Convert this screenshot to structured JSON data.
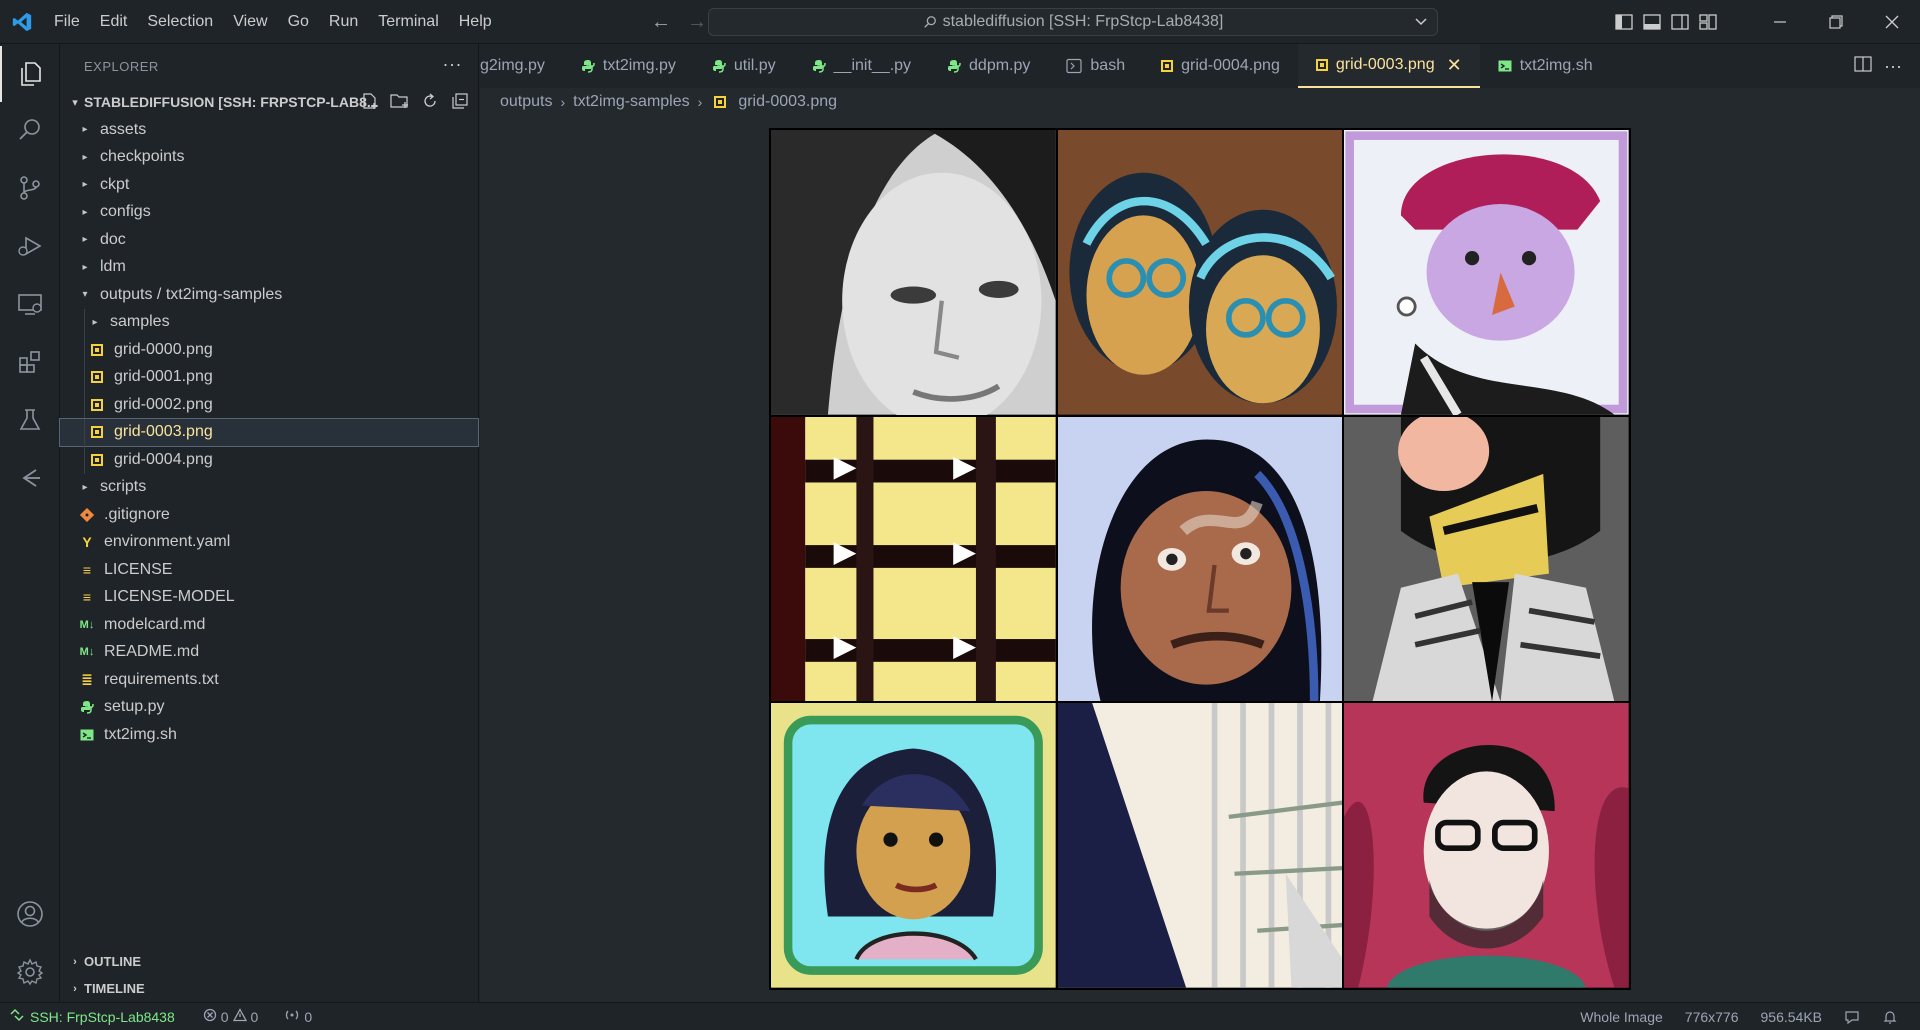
{
  "titlebar": {
    "menu": [
      "File",
      "Edit",
      "Selection",
      "View",
      "Go",
      "Run",
      "Terminal",
      "Help"
    ],
    "command_center": "stablediffusion [SSH: FrpStcp-Lab8438]"
  },
  "sidebar": {
    "header": "EXPLORER",
    "root": "STABLEDIFFUSION [SSH: FRPSTCP-LAB8...",
    "tree": [
      {
        "label": "assets",
        "type": "folder"
      },
      {
        "label": "checkpoints",
        "type": "folder"
      },
      {
        "label": "ckpt",
        "type": "folder"
      },
      {
        "label": "configs",
        "type": "folder"
      },
      {
        "label": "doc",
        "type": "folder"
      },
      {
        "label": "ldm",
        "type": "folder"
      },
      {
        "label": "outputs / txt2img-samples",
        "type": "folder-open"
      },
      {
        "label": "samples",
        "type": "folder",
        "indent": 1
      },
      {
        "label": "grid-0000.png",
        "type": "png",
        "indent": 1
      },
      {
        "label": "grid-0001.png",
        "type": "png",
        "indent": 1
      },
      {
        "label": "grid-0002.png",
        "type": "png",
        "indent": 1
      },
      {
        "label": "grid-0003.png",
        "type": "png",
        "indent": 1,
        "selected": true
      },
      {
        "label": "grid-0004.png",
        "type": "png",
        "indent": 1
      },
      {
        "label": "scripts",
        "type": "folder"
      },
      {
        "label": ".gitignore",
        "type": "git"
      },
      {
        "label": "environment.yaml",
        "type": "yaml"
      },
      {
        "label": "LICENSE",
        "type": "license"
      },
      {
        "label": "LICENSE-MODEL",
        "type": "license"
      },
      {
        "label": "modelcard.md",
        "type": "md"
      },
      {
        "label": "README.md",
        "type": "md"
      },
      {
        "label": "requirements.txt",
        "type": "txt"
      },
      {
        "label": "setup.py",
        "type": "py"
      },
      {
        "label": "txt2img.sh",
        "type": "sh"
      }
    ],
    "outline": "OUTLINE",
    "timeline": "TIMELINE"
  },
  "tabs": [
    {
      "label": "g2img.py",
      "icon": "none"
    },
    {
      "label": "txt2img.py",
      "icon": "py"
    },
    {
      "label": "util.py",
      "icon": "py"
    },
    {
      "label": "__init__.py",
      "icon": "py"
    },
    {
      "label": "ddpm.py",
      "icon": "py"
    },
    {
      "label": "bash",
      "icon": "terminal"
    },
    {
      "label": "grid-0004.png",
      "icon": "png"
    },
    {
      "label": "grid-0003.png",
      "icon": "png",
      "active": true
    },
    {
      "label": "txt2img.sh",
      "icon": "sh"
    }
  ],
  "breadcrumb": {
    "folder": "outputs",
    "subfolder": "txt2img-samples",
    "file": "grid-0003.png"
  },
  "statusbar": {
    "remote": "SSH: FrpStcp-Lab8438",
    "errors": "0",
    "warnings": "0",
    "ports": "0",
    "view_mode": "Whole Image",
    "dimensions": "776x776",
    "file_size": "956.54KB"
  }
}
